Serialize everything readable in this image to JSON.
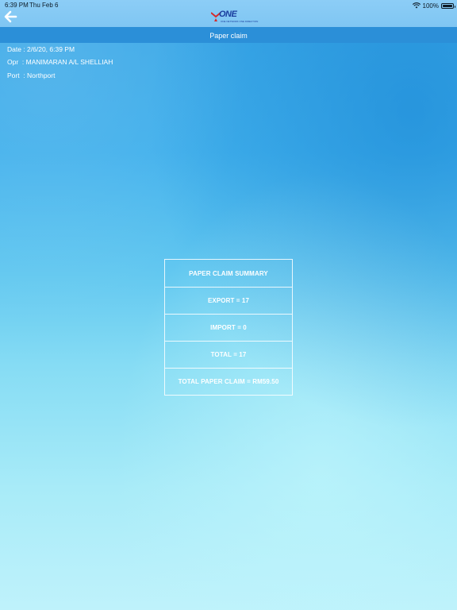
{
  "status_bar": {
    "time": "6:39 PM",
    "date": "Thu Feb 6",
    "battery": "100%",
    "battery_level": 1.0
  },
  "header": {
    "back_icon": "arrow-left-icon",
    "logo_text": "ONE",
    "logo_tagline": "ONE NETWORK ONE DIRECTION",
    "logo_colors": {
      "primary": "#1a3e9e",
      "accent": "#d62a2a"
    }
  },
  "title": "Paper claim",
  "info": {
    "date": "Date : 2/6/20, 6:39 PM",
    "operator": "Opr  : MANIMARAN A/L SHELLIAH",
    "port": "Port  : Northport"
  },
  "summary": {
    "rows": [
      "PAPER CLAIM SUMMARY",
      "EXPORT = 17",
      "IMPORT = 0",
      "TOTAL = 17",
      "TOTAL PAPER CLAIM = RM59.50"
    ]
  }
}
